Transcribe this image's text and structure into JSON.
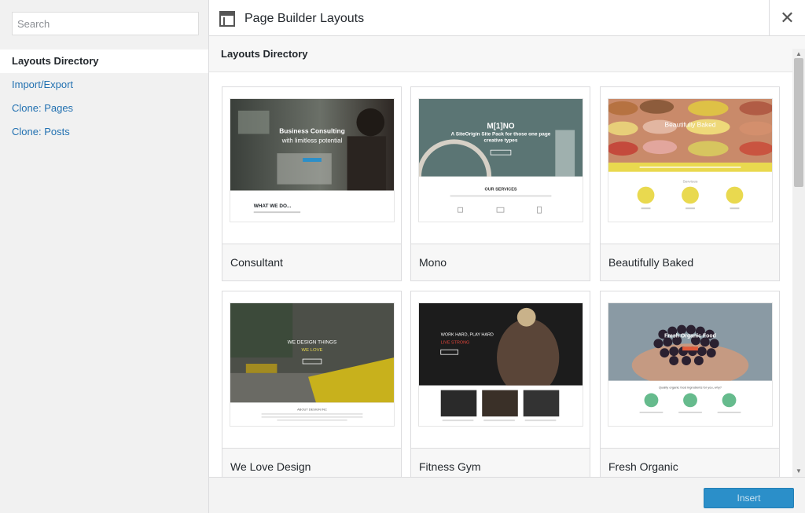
{
  "sidebar": {
    "search_placeholder": "Search",
    "items": [
      {
        "label": "Layouts Directory",
        "active": true
      },
      {
        "label": "Import/Export",
        "active": false
      },
      {
        "label": "Clone: Pages",
        "active": false
      },
      {
        "label": "Clone: Posts",
        "active": false
      }
    ]
  },
  "header": {
    "title": "Page Builder Layouts",
    "close_glyph": "✕"
  },
  "content": {
    "section_title": "Layouts Directory"
  },
  "layouts": [
    {
      "name": "Consultant",
      "thumb": {
        "hero_title": "Business Consulting",
        "hero_sub": "with limitless potential",
        "section_heading": "WHAT WE DO..."
      }
    },
    {
      "name": "Mono",
      "thumb": {
        "hero_title": "M[1]NO",
        "hero_sub": "A SiteOrigin Site Pack for those one page creative types",
        "section_heading": "OUR SERVICES"
      }
    },
    {
      "name": "Beautifully Baked",
      "thumb": {
        "hero_title": "Beautifully Baked",
        "section_heading": "Services"
      }
    },
    {
      "name": "We Love Design",
      "thumb": {
        "hero_title": "WE DESIGN THINGS",
        "hero_sub": "WE LOVE",
        "section_heading": "ABOUT DESIGN INC"
      }
    },
    {
      "name": "Fitness Gym",
      "thumb": {
        "hero_title": "WORK HARD, PLAY HARD",
        "hero_sub": "LIVE STRONG"
      }
    },
    {
      "name": "Fresh Organic",
      "thumb": {
        "hero_title": "Fresh Organic Food",
        "section_heading": "Quality organic food ingredients for you, why?"
      }
    }
  ],
  "footer": {
    "insert_label": "Insert"
  },
  "colors": {
    "accent": "#2b8fc9",
    "link": "#2271b1",
    "sidebar_bg": "#f1f1f1",
    "baked_yellow": "#e9d94f",
    "organic_green": "#66bb8d"
  }
}
